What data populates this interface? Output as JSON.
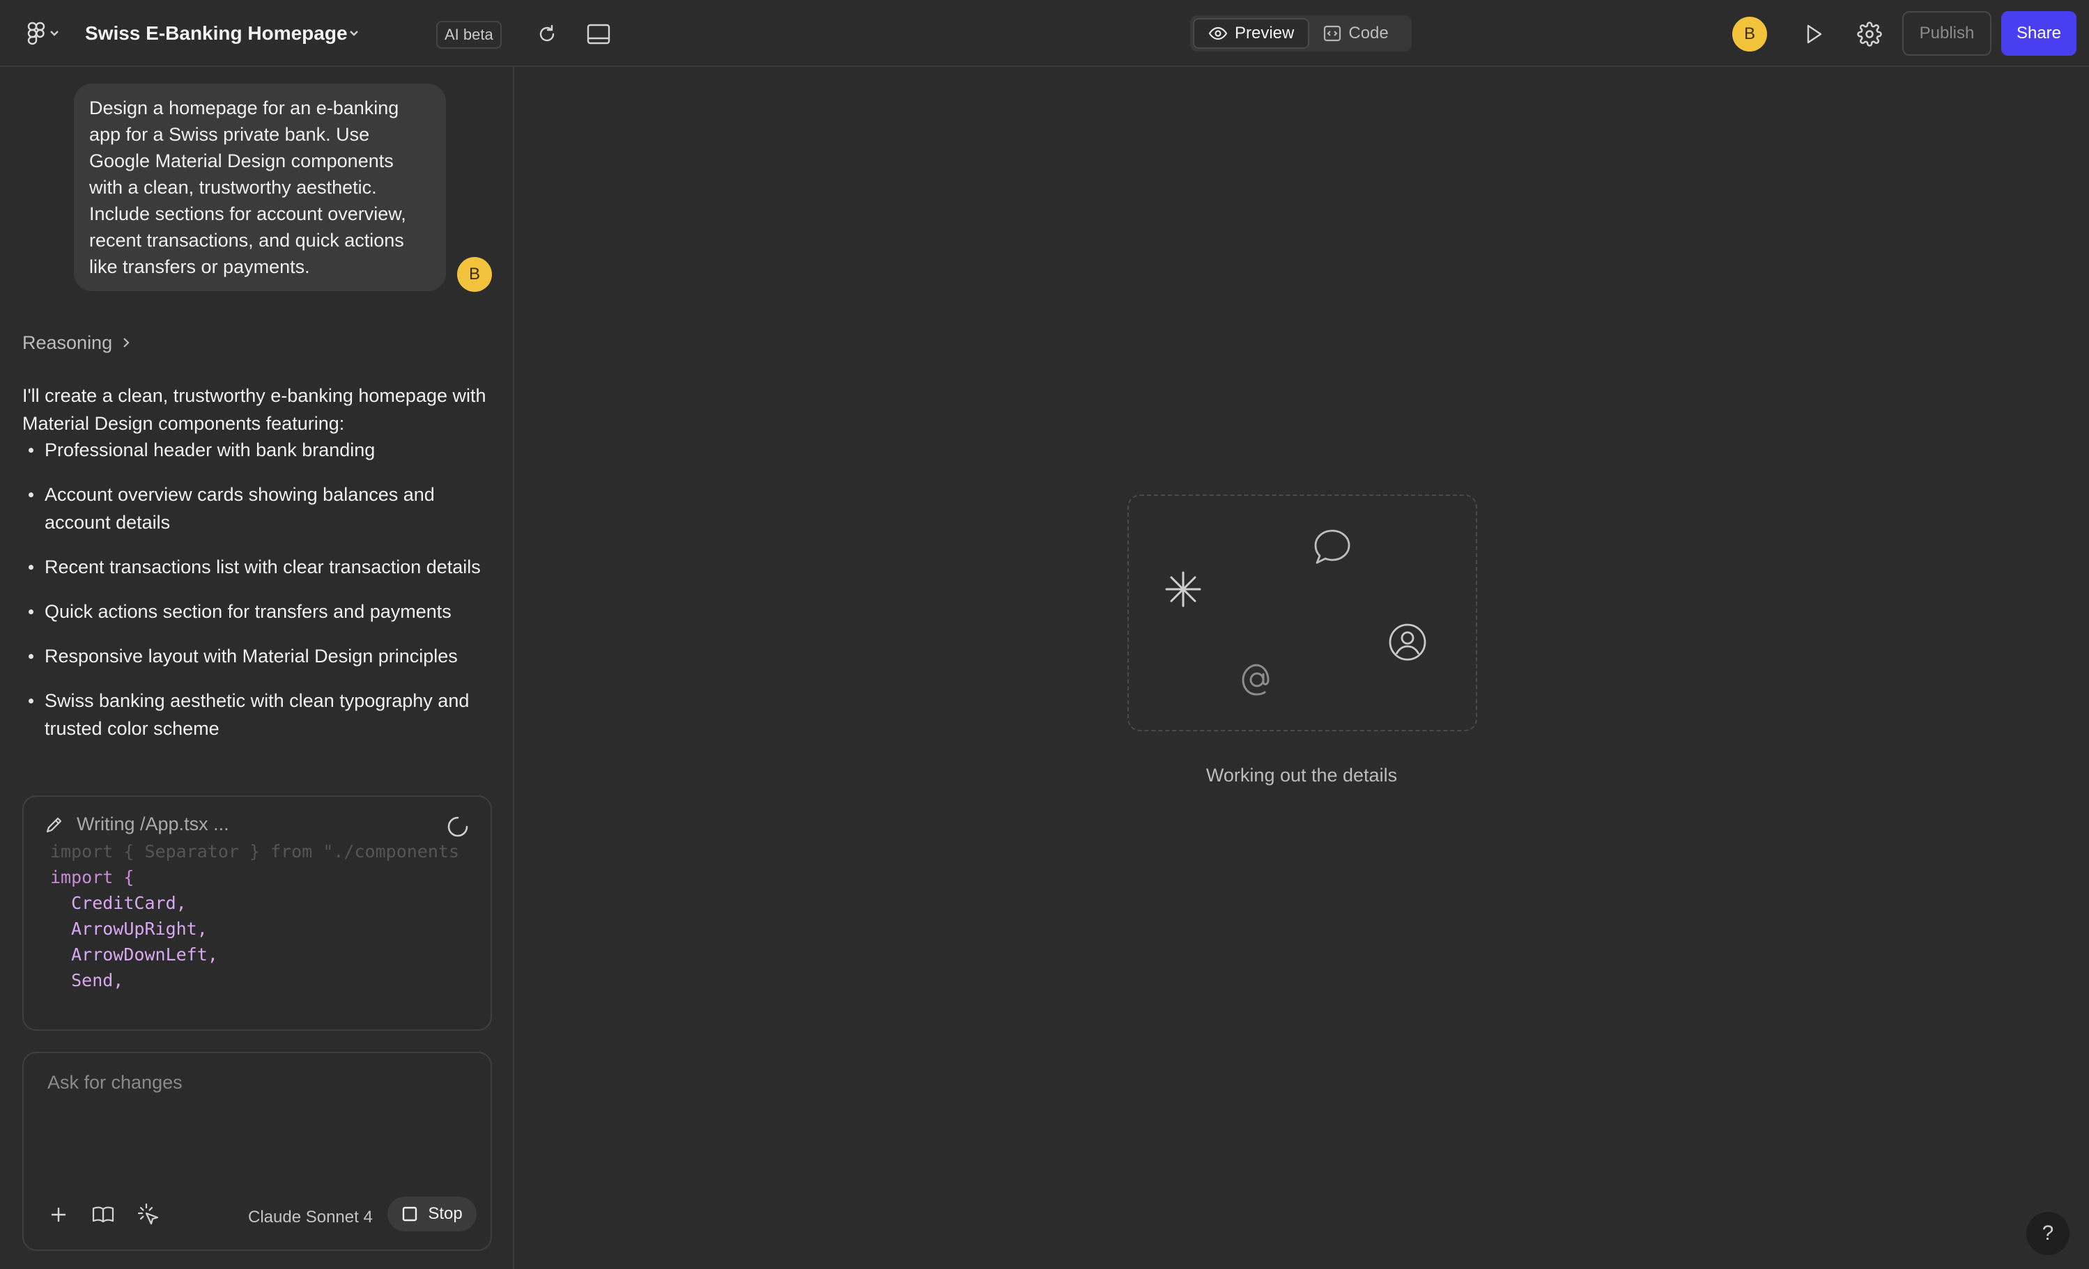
{
  "header": {
    "logo_icon": "figma-logo-icon",
    "project_title": "Swiss E-Banking Homepage",
    "ai_badge": "AI beta",
    "tabs": [
      {
        "label": "Preview",
        "icon": "eye-icon",
        "active": true
      },
      {
        "label": "Code",
        "icon": "code-icon",
        "active": false
      }
    ],
    "user_initial": "B",
    "publish_label": "Publish",
    "share_label": "Share",
    "accent_color": "#4a3ff0",
    "avatar_color": "#f3c33c"
  },
  "chat": {
    "user_message": "Design a homepage for an e-banking app for a Swiss private bank. Use Google Material Design components with a clean, trustworthy aesthetic. Include sections for account overview, recent transactions, and quick actions like transfers or payments.",
    "user_initial": "B",
    "reasoning_label": "Reasoning",
    "assistant_intro": "I'll create a clean, trustworthy e-banking homepage with Material Design components featuring:",
    "bullets": [
      "Professional header with bank branding",
      "Account overview cards showing balances and account details",
      "Recent transactions list with clear transaction details",
      "Quick actions section for transfers and payments",
      "Responsive layout with Material Design principles",
      "Swiss banking aesthetic with clean typography and trusted color scheme"
    ],
    "code_status": "Writing /App.tsx ...",
    "code_lines": {
      "l0": "import { Separator } from \"./components",
      "l1": "import {",
      "l2": "  CreditCard,",
      "l3": "  ArrowUpRight,",
      "l4": "  ArrowDownLeft,",
      "l5": "  Send,"
    }
  },
  "composer": {
    "placeholder": "Ask for changes",
    "model": "Claude Sonnet 4",
    "stop_label": "Stop"
  },
  "canvas": {
    "status": "Working out the details",
    "help": "?"
  }
}
